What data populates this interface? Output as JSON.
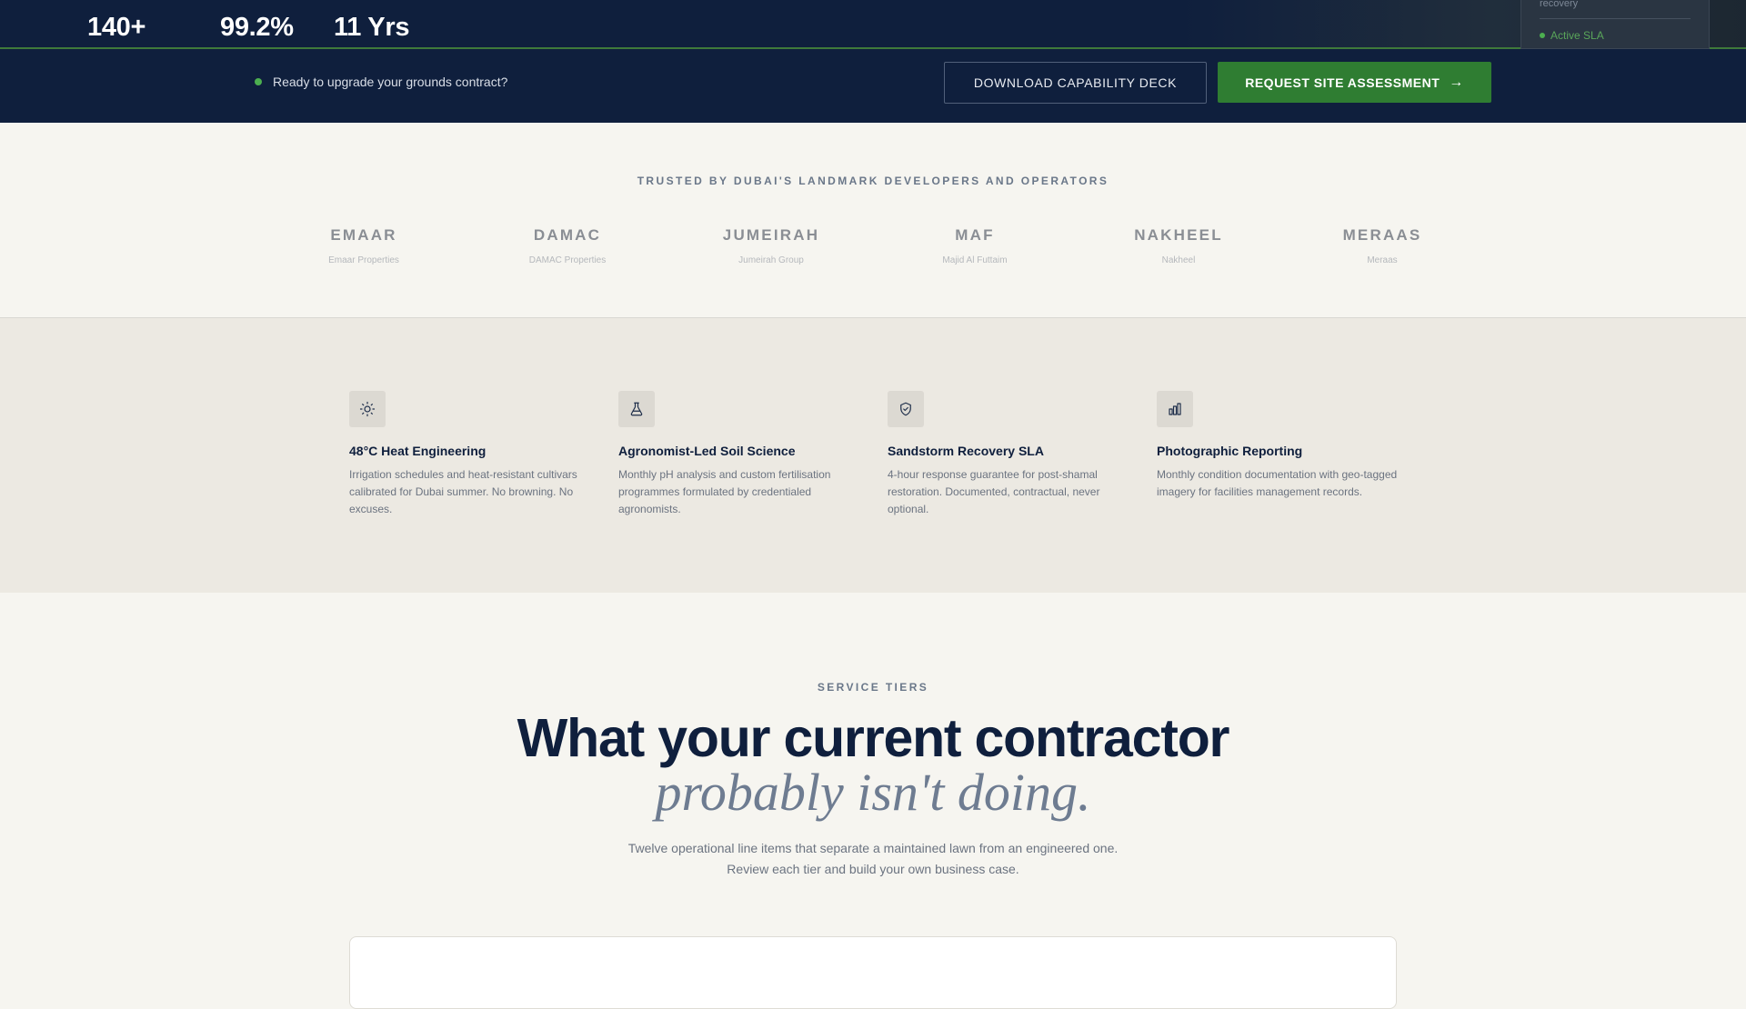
{
  "stats": [
    {
      "value": "140+"
    },
    {
      "value": "99.2%"
    },
    {
      "value": "11 Yrs"
    }
  ],
  "sla_card": {
    "description": "recovery",
    "status": "Active SLA"
  },
  "cta": {
    "prompt": "Ready to upgrade your grounds contract?",
    "download_label": "DOWNLOAD CAPABILITY DECK",
    "request_label": "REQUEST SITE ASSESSMENT"
  },
  "trusted": {
    "heading": "TRUSTED BY DUBAI'S LANDMARK DEVELOPERS AND OPERATORS",
    "brands": [
      {
        "name": "EMAAR",
        "sub": "Emaar Properties"
      },
      {
        "name": "DAMAC",
        "sub": "DAMAC Properties"
      },
      {
        "name": "JUMEIRAH",
        "sub": "Jumeirah Group"
      },
      {
        "name": "MAF",
        "sub": "Majid Al Futtaim"
      },
      {
        "name": "NAKHEEL",
        "sub": "Nakheel"
      },
      {
        "name": "MERAAS",
        "sub": "Meraas"
      }
    ]
  },
  "features": [
    {
      "icon": "sun-icon",
      "title": "48°C Heat Engineering",
      "desc": "Irrigation schedules and heat-resistant cultivars calibrated for Dubai summer. No browning. No excuses."
    },
    {
      "icon": "flask-icon",
      "title": "Agronomist-Led Soil Science",
      "desc": "Monthly pH analysis and custom fertilisation programmes formulated by credentialed agronomists."
    },
    {
      "icon": "shield-check-icon",
      "title": "Sandstorm Recovery SLA",
      "desc": "4-hour response guarantee for post-shamal restoration. Documented, contractual, never optional."
    },
    {
      "icon": "bar-chart-icon",
      "title": "Photographic Reporting",
      "desc": "Monthly condition documentation with geo-tagged imagery for facilities management records."
    }
  ],
  "tiers": {
    "eyebrow": "SERVICE TIERS",
    "headline": "What your current contractor",
    "headline_italic": "probably isn't doing.",
    "lede_line1": "Twelve operational line items that separate a maintained lawn from an engineered one.",
    "lede_line2": "Review each tier and build your own business case."
  },
  "colors": {
    "navy": "#0f1f3d",
    "accent_green": "#2f7d32",
    "cream": "#f6f5f0",
    "sand": "#ece9e2"
  }
}
